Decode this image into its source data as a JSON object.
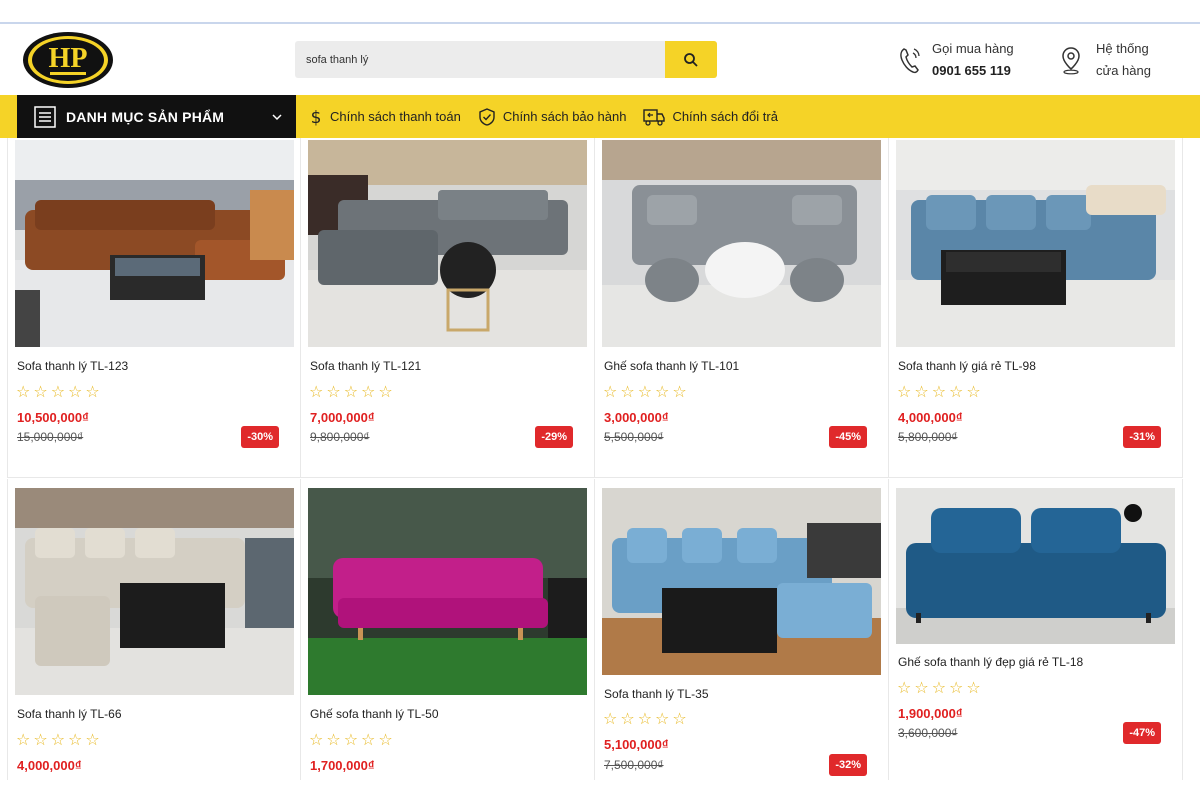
{
  "header": {
    "logo_text": "HP",
    "search_value": "sofa thanh lý",
    "phone_label": "Gọi mua hàng",
    "phone_number": "0901 655 119",
    "store_label_1": "Hệ thống",
    "store_label_2": "cửa hàng"
  },
  "nav": {
    "category_label": "DANH MỤC SẢN PHẨM",
    "links": [
      "Chính sách thanh toán",
      "Chính sách bảo hành",
      "Chính sách đổi trả"
    ]
  },
  "products": [
    {
      "name": "Sofa thanh lý TL-123",
      "price": "10,500,000₫",
      "old_price": "15,000,000₫",
      "discount": "-30%",
      "stars": "☆☆☆☆☆"
    },
    {
      "name": "Sofa thanh lý TL-121",
      "price": "7,000,000₫",
      "old_price": "9,800,000₫",
      "discount": "-29%",
      "stars": "☆☆☆☆☆"
    },
    {
      "name": "Ghế sofa thanh lý TL-101",
      "price": "3,000,000₫",
      "old_price": "5,500,000₫",
      "discount": "-45%",
      "stars": "☆☆☆☆☆"
    },
    {
      "name": "Sofa thanh lý giá rẻ TL-98",
      "price": "4,000,000₫",
      "old_price": "5,800,000₫",
      "discount": "-31%",
      "stars": "☆☆☆☆☆"
    },
    {
      "name": "Sofa thanh lý TL-66",
      "price": "4,000,000₫",
      "stars": "☆☆☆☆☆"
    },
    {
      "name": "Ghế sofa thanh lý TL-50",
      "price": "1,700,000₫",
      "stars": "☆☆☆☆☆"
    },
    {
      "name": "Sofa thanh lý TL-35",
      "price": "5,100,000₫",
      "old_price": "7,500,000₫",
      "discount": "-32%",
      "stars": "☆☆☆☆☆"
    },
    {
      "name": "Ghế sofa thanh lý đẹp giá rẻ TL-18",
      "price": "1,900,000₫",
      "old_price": "3,600,000₫",
      "discount": "-47%",
      "stars": "☆☆☆☆☆"
    }
  ],
  "colors": {
    "accent_yellow": "#f5d327",
    "price_red": "#e02020",
    "badge_red": "#e0292b"
  }
}
